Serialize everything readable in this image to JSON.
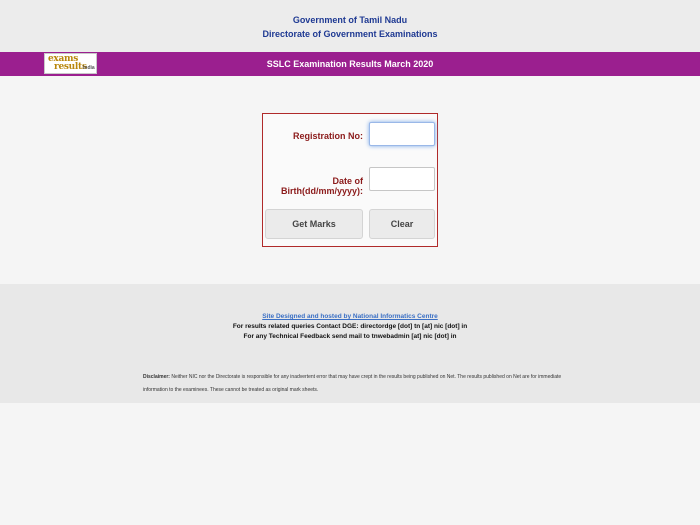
{
  "header": {
    "line1": "Government of Tamil Nadu",
    "line2": "Directorate of Government Examinations"
  },
  "banner": {
    "title": "SSLC  Examination Results  March 2020",
    "logo": {
      "word1": "exams",
      "word2": "results",
      "word3": "India"
    }
  },
  "form": {
    "registration_label": "Registration No:",
    "registration_value": "",
    "dob_label": "Date of Birth(dd/mm/yyyy):",
    "dob_value": "",
    "get_marks_label": "Get Marks",
    "clear_label": "Clear"
  },
  "footer": {
    "link": "Site Designed and hosted by National Informatics Centre",
    "queries": "For results related queries Contact DGE:  directordge [dot] tn [at] nic [dot] in",
    "technical": "For any Technical Feedback send mail to tnwebadmin [at] nic [dot] in",
    "disclaimer_label": "Disclaimer:",
    "disclaimer_text": " Neither NIC nor the Directorate is responsible for any inadvertent error that may have crept in the results being published on Net. The results published on Net are for immediate information to the examinees. These cannot be treated as original mark sheets."
  },
  "colors": {
    "banner": "#9b1f8f",
    "header_text": "#1f3a93",
    "label_text": "#8b1a1a",
    "form_border": "#b02a2a",
    "link": "#3a6fc4"
  }
}
